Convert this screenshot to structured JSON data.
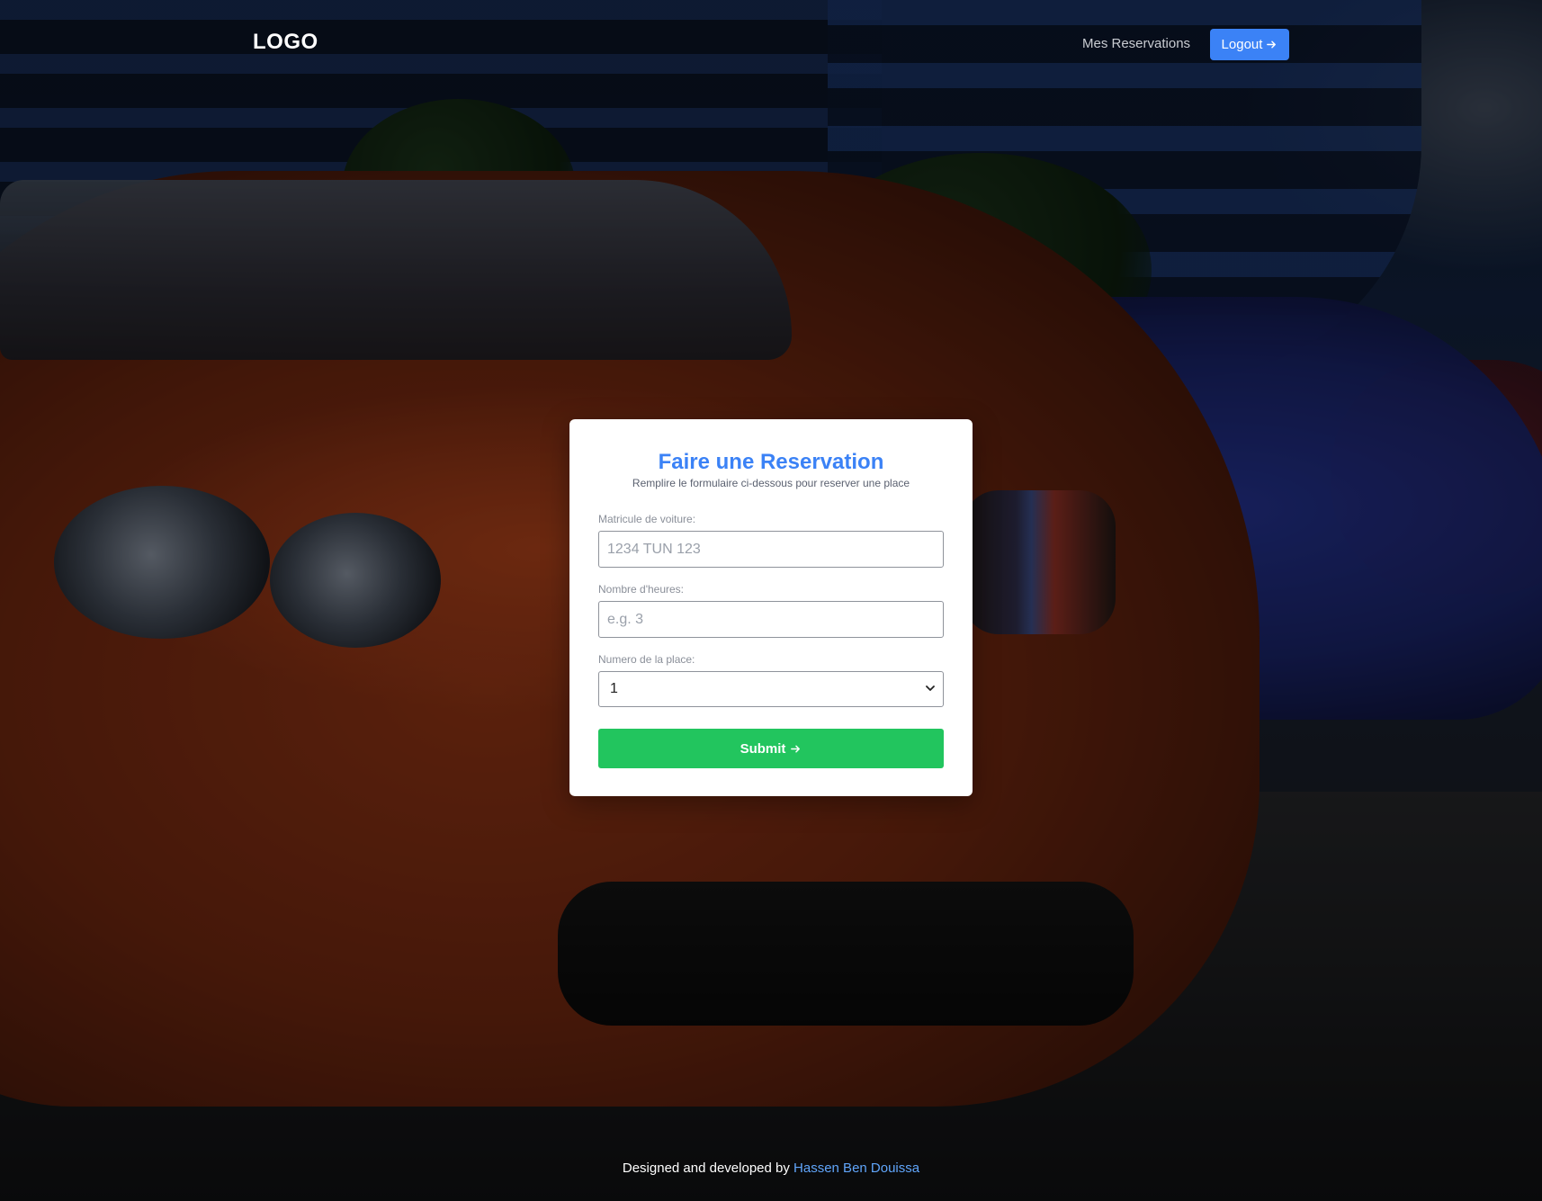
{
  "header": {
    "logo": "LOGO",
    "nav_link": "Mes Reservations",
    "logout_label": "Logout",
    "logout_icon": "arrow-right-icon"
  },
  "form": {
    "title": "Faire une Reservation",
    "subtitle": "Remplire le formulaire ci-dessous pour reserver une place",
    "matricule": {
      "label": "Matricule de voiture:",
      "placeholder": "1234 TUN 123",
      "value": ""
    },
    "heures": {
      "label": "Nombre d'heures:",
      "placeholder": "e.g. 3",
      "value": ""
    },
    "place": {
      "label": "Numero de la place:",
      "selected": "1"
    },
    "submit_label": "Submit",
    "submit_icon": "arrow-right-icon"
  },
  "footer": {
    "prefix": "Designed and developed by",
    "author": "Hassen Ben Douissa"
  },
  "colors": {
    "primary": "#3b82f6",
    "submit": "#22c55e",
    "footer_link": "#60a5fa"
  }
}
